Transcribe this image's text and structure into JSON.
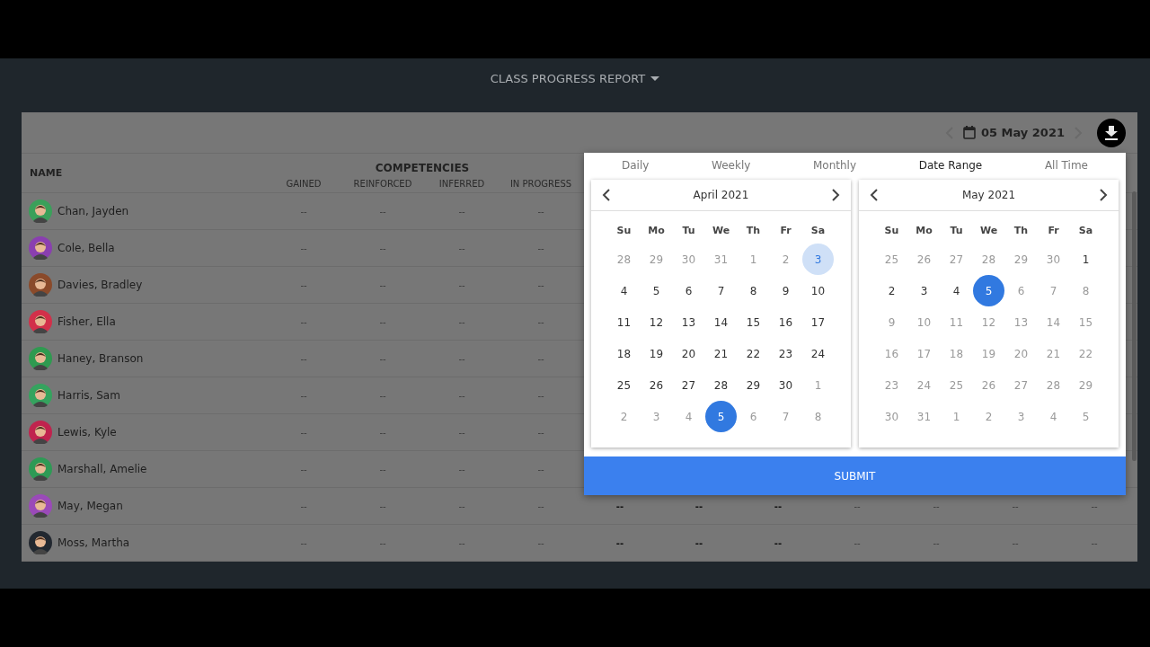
{
  "header": {
    "title": "CLASS PROGRESS REPORT"
  },
  "date_nav": {
    "date": "05 May 2021"
  },
  "table": {
    "name_header": "NAME",
    "group_header": "COMPETENCIES",
    "columns": [
      "GAINED",
      "REINFORCED",
      "INFERRED",
      "IN PROGRESS"
    ],
    "rows": [
      {
        "name": "Chan, Jayden",
        "color": "#3aa05a",
        "cells": [
          {
            "text": "--",
            "strong": false
          },
          {
            "text": "--",
            "strong": false
          },
          {
            "text": "--",
            "strong": false
          },
          {
            "text": "--",
            "strong": false
          }
        ]
      },
      {
        "name": "Cole, Bella",
        "color": "#8a3fb0",
        "cells": [
          {
            "text": "--",
            "strong": false
          },
          {
            "text": "--",
            "strong": false
          },
          {
            "text": "--",
            "strong": false
          },
          {
            "text": "--",
            "strong": false
          }
        ]
      },
      {
        "name": "Davies, Bradley",
        "color": "#8a4a2a",
        "cells": [
          {
            "text": "--",
            "strong": false
          },
          {
            "text": "--",
            "strong": false
          },
          {
            "text": "--",
            "strong": false
          },
          {
            "text": "--",
            "strong": false
          }
        ]
      },
      {
        "name": "Fisher, Ella",
        "color": "#d2304a",
        "cells": [
          {
            "text": "--",
            "strong": false
          },
          {
            "text": "--",
            "strong": false
          },
          {
            "text": "--",
            "strong": false
          },
          {
            "text": "--",
            "strong": false
          }
        ]
      },
      {
        "name": "Haney, Branson",
        "color": "#2f9a50",
        "cells": [
          {
            "text": "--",
            "strong": false
          },
          {
            "text": "--",
            "strong": false
          },
          {
            "text": "--",
            "strong": false
          },
          {
            "text": "--",
            "strong": false
          }
        ]
      },
      {
        "name": "Harris, Sam",
        "color": "#35a35e",
        "cells": [
          {
            "text": "--",
            "strong": false
          },
          {
            "text": "--",
            "strong": false
          },
          {
            "text": "--",
            "strong": false
          },
          {
            "text": "--",
            "strong": false
          }
        ]
      },
      {
        "name": "Lewis, Kyle",
        "color": "#c0234e",
        "cells": [
          {
            "text": "--",
            "strong": false
          },
          {
            "text": "--",
            "strong": false
          },
          {
            "text": "--",
            "strong": false
          },
          {
            "text": "--",
            "strong": false
          }
        ]
      },
      {
        "name": "Marshall, Amelie",
        "color": "#2e9a55",
        "cells": [
          {
            "text": "--",
            "strong": false
          },
          {
            "text": "--",
            "strong": false
          },
          {
            "text": "--",
            "strong": false
          },
          {
            "text": "--",
            "strong": false
          }
        ]
      },
      {
        "name": "May, Megan",
        "color": "#9a4ab8",
        "cells": [
          {
            "text": "--",
            "strong": false
          },
          {
            "text": "--",
            "strong": false
          },
          {
            "text": "--",
            "strong": false
          },
          {
            "text": "--",
            "strong": false
          },
          {
            "text": "--",
            "strong": true
          },
          {
            "text": "--",
            "strong": true
          },
          {
            "text": "--",
            "strong": true
          },
          {
            "text": "--",
            "strong": false
          },
          {
            "text": "--",
            "strong": false
          },
          {
            "text": "--",
            "strong": false
          },
          {
            "text": "--",
            "strong": false
          }
        ]
      },
      {
        "name": "Moss, Martha",
        "color": "#222830",
        "cells": [
          {
            "text": "--",
            "strong": false
          },
          {
            "text": "--",
            "strong": false
          },
          {
            "text": "--",
            "strong": false
          },
          {
            "text": "--",
            "strong": false
          },
          {
            "text": "--",
            "strong": true
          },
          {
            "text": "--",
            "strong": true
          },
          {
            "text": "--",
            "strong": true
          },
          {
            "text": "--",
            "strong": false
          },
          {
            "text": "--",
            "strong": false
          },
          {
            "text": "--",
            "strong": false
          },
          {
            "text": "--",
            "strong": false
          }
        ]
      }
    ]
  },
  "picker": {
    "tabs": [
      {
        "label": "Daily",
        "selected": false
      },
      {
        "label": "Weekly",
        "selected": false
      },
      {
        "label": "Monthly",
        "selected": false
      },
      {
        "label": "Date Range",
        "selected": true
      },
      {
        "label": "All Time",
        "selected": false
      }
    ],
    "calendars": [
      {
        "title": "April 2021",
        "weekdays": [
          "Su",
          "Mo",
          "Tu",
          "We",
          "Th",
          "Fr",
          "Sa"
        ],
        "weeks": [
          [
            {
              "day": "28",
              "muted": true,
              "selected": false,
              "highlighted": false
            },
            {
              "day": "29",
              "muted": true,
              "selected": false,
              "highlighted": false
            },
            {
              "day": "30",
              "muted": true,
              "selected": false,
              "highlighted": false
            },
            {
              "day": "31",
              "muted": true,
              "selected": false,
              "highlighted": false
            },
            {
              "day": "1",
              "muted": true,
              "selected": false,
              "highlighted": false
            },
            {
              "day": "2",
              "muted": true,
              "selected": false,
              "highlighted": false
            },
            {
              "day": "3",
              "muted": false,
              "selected": false,
              "highlighted": true
            }
          ],
          [
            {
              "day": "4",
              "muted": false,
              "selected": false,
              "highlighted": false
            },
            {
              "day": "5",
              "muted": false,
              "selected": false,
              "highlighted": false
            },
            {
              "day": "6",
              "muted": false,
              "selected": false,
              "highlighted": false
            },
            {
              "day": "7",
              "muted": false,
              "selected": false,
              "highlighted": false
            },
            {
              "day": "8",
              "muted": false,
              "selected": false,
              "highlighted": false
            },
            {
              "day": "9",
              "muted": false,
              "selected": false,
              "highlighted": false
            },
            {
              "day": "10",
              "muted": false,
              "selected": false,
              "highlighted": false
            }
          ],
          [
            {
              "day": "11",
              "muted": false,
              "selected": false,
              "highlighted": false
            },
            {
              "day": "12",
              "muted": false,
              "selected": false,
              "highlighted": false
            },
            {
              "day": "13",
              "muted": false,
              "selected": false,
              "highlighted": false
            },
            {
              "day": "14",
              "muted": false,
              "selected": false,
              "highlighted": false
            },
            {
              "day": "15",
              "muted": false,
              "selected": false,
              "highlighted": false
            },
            {
              "day": "16",
              "muted": false,
              "selected": false,
              "highlighted": false
            },
            {
              "day": "17",
              "muted": false,
              "selected": false,
              "highlighted": false
            }
          ],
          [
            {
              "day": "18",
              "muted": false,
              "selected": false,
              "highlighted": false
            },
            {
              "day": "19",
              "muted": false,
              "selected": false,
              "highlighted": false
            },
            {
              "day": "20",
              "muted": false,
              "selected": false,
              "highlighted": false
            },
            {
              "day": "21",
              "muted": false,
              "selected": false,
              "highlighted": false
            },
            {
              "day": "22",
              "muted": false,
              "selected": false,
              "highlighted": false
            },
            {
              "day": "23",
              "muted": false,
              "selected": false,
              "highlighted": false
            },
            {
              "day": "24",
              "muted": false,
              "selected": false,
              "highlighted": false
            }
          ],
          [
            {
              "day": "25",
              "muted": false,
              "selected": false,
              "highlighted": false
            },
            {
              "day": "26",
              "muted": false,
              "selected": false,
              "highlighted": false
            },
            {
              "day": "27",
              "muted": false,
              "selected": false,
              "highlighted": false
            },
            {
              "day": "28",
              "muted": false,
              "selected": false,
              "highlighted": false
            },
            {
              "day": "29",
              "muted": false,
              "selected": false,
              "highlighted": false
            },
            {
              "day": "30",
              "muted": false,
              "selected": false,
              "highlighted": false
            },
            {
              "day": "1",
              "muted": true,
              "selected": false,
              "highlighted": false
            }
          ],
          [
            {
              "day": "2",
              "muted": true,
              "selected": false,
              "highlighted": false
            },
            {
              "day": "3",
              "muted": true,
              "selected": false,
              "highlighted": false
            },
            {
              "day": "4",
              "muted": true,
              "selected": false,
              "highlighted": false
            },
            {
              "day": "5",
              "muted": false,
              "selected": true,
              "highlighted": false
            },
            {
              "day": "6",
              "muted": true,
              "selected": false,
              "highlighted": false
            },
            {
              "day": "7",
              "muted": true,
              "selected": false,
              "highlighted": false
            },
            {
              "day": "8",
              "muted": true,
              "selected": false,
              "highlighted": false
            }
          ]
        ]
      },
      {
        "title": "May 2021",
        "weekdays": [
          "Su",
          "Mo",
          "Tu",
          "We",
          "Th",
          "Fr",
          "Sa"
        ],
        "weeks": [
          [
            {
              "day": "25",
              "muted": true,
              "selected": false,
              "highlighted": false
            },
            {
              "day": "26",
              "muted": true,
              "selected": false,
              "highlighted": false
            },
            {
              "day": "27",
              "muted": true,
              "selected": false,
              "highlighted": false
            },
            {
              "day": "28",
              "muted": true,
              "selected": false,
              "highlighted": false
            },
            {
              "day": "29",
              "muted": true,
              "selected": false,
              "highlighted": false
            },
            {
              "day": "30",
              "muted": true,
              "selected": false,
              "highlighted": false
            },
            {
              "day": "1",
              "muted": false,
              "selected": false,
              "highlighted": false
            }
          ],
          [
            {
              "day": "2",
              "muted": false,
              "selected": false,
              "highlighted": false
            },
            {
              "day": "3",
              "muted": false,
              "selected": false,
              "highlighted": false
            },
            {
              "day": "4",
              "muted": false,
              "selected": false,
              "highlighted": false
            },
            {
              "day": "5",
              "muted": false,
              "selected": true,
              "highlighted": false
            },
            {
              "day": "6",
              "muted": true,
              "selected": false,
              "highlighted": false
            },
            {
              "day": "7",
              "muted": true,
              "selected": false,
              "highlighted": false
            },
            {
              "day": "8",
              "muted": true,
              "selected": false,
              "highlighted": false
            }
          ],
          [
            {
              "day": "9",
              "muted": true,
              "selected": false,
              "highlighted": false
            },
            {
              "day": "10",
              "muted": true,
              "selected": false,
              "highlighted": false
            },
            {
              "day": "11",
              "muted": true,
              "selected": false,
              "highlighted": false
            },
            {
              "day": "12",
              "muted": true,
              "selected": false,
              "highlighted": false
            },
            {
              "day": "13",
              "muted": true,
              "selected": false,
              "highlighted": false
            },
            {
              "day": "14",
              "muted": true,
              "selected": false,
              "highlighted": false
            },
            {
              "day": "15",
              "muted": true,
              "selected": false,
              "highlighted": false
            }
          ],
          [
            {
              "day": "16",
              "muted": true,
              "selected": false,
              "highlighted": false
            },
            {
              "day": "17",
              "muted": true,
              "selected": false,
              "highlighted": false
            },
            {
              "day": "18",
              "muted": true,
              "selected": false,
              "highlighted": false
            },
            {
              "day": "19",
              "muted": true,
              "selected": false,
              "highlighted": false
            },
            {
              "day": "20",
              "muted": true,
              "selected": false,
              "highlighted": false
            },
            {
              "day": "21",
              "muted": true,
              "selected": false,
              "highlighted": false
            },
            {
              "day": "22",
              "muted": true,
              "selected": false,
              "highlighted": false
            }
          ],
          [
            {
              "day": "23",
              "muted": true,
              "selected": false,
              "highlighted": false
            },
            {
              "day": "24",
              "muted": true,
              "selected": false,
              "highlighted": false
            },
            {
              "day": "25",
              "muted": true,
              "selected": false,
              "highlighted": false
            },
            {
              "day": "26",
              "muted": true,
              "selected": false,
              "highlighted": false
            },
            {
              "day": "27",
              "muted": true,
              "selected": false,
              "highlighted": false
            },
            {
              "day": "28",
              "muted": true,
              "selected": false,
              "highlighted": false
            },
            {
              "day": "29",
              "muted": true,
              "selected": false,
              "highlighted": false
            }
          ],
          [
            {
              "day": "30",
              "muted": true,
              "selected": false,
              "highlighted": false
            },
            {
              "day": "31",
              "muted": true,
              "selected": false,
              "highlighted": false
            },
            {
              "day": "1",
              "muted": true,
              "selected": false,
              "highlighted": false
            },
            {
              "day": "2",
              "muted": true,
              "selected": false,
              "highlighted": false
            },
            {
              "day": "3",
              "muted": true,
              "selected": false,
              "highlighted": false
            },
            {
              "day": "4",
              "muted": true,
              "selected": false,
              "highlighted": false
            },
            {
              "day": "5",
              "muted": true,
              "selected": false,
              "highlighted": false
            }
          ]
        ]
      }
    ],
    "submit": "SUBMIT"
  }
}
